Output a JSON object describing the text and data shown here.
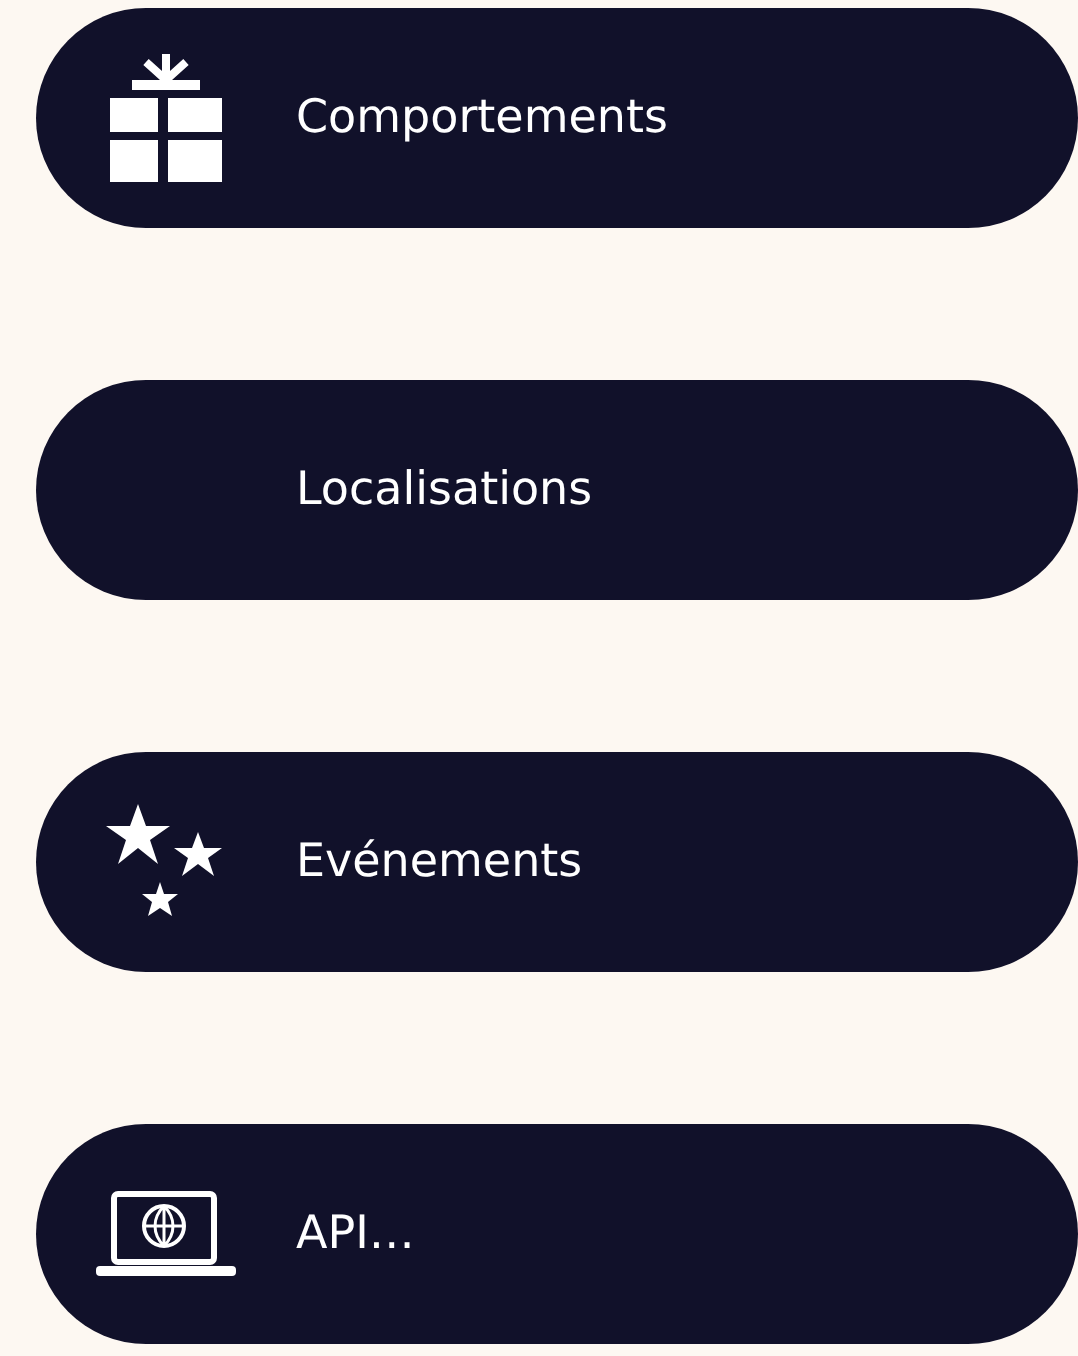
{
  "menu_items": [
    {
      "kind": "gift",
      "label": "Comportements"
    },
    {
      "kind": "plain",
      "label": "Localisations"
    },
    {
      "kind": "stars",
      "label": "Evénements"
    },
    {
      "kind": "laptop",
      "label": "API…"
    }
  ]
}
